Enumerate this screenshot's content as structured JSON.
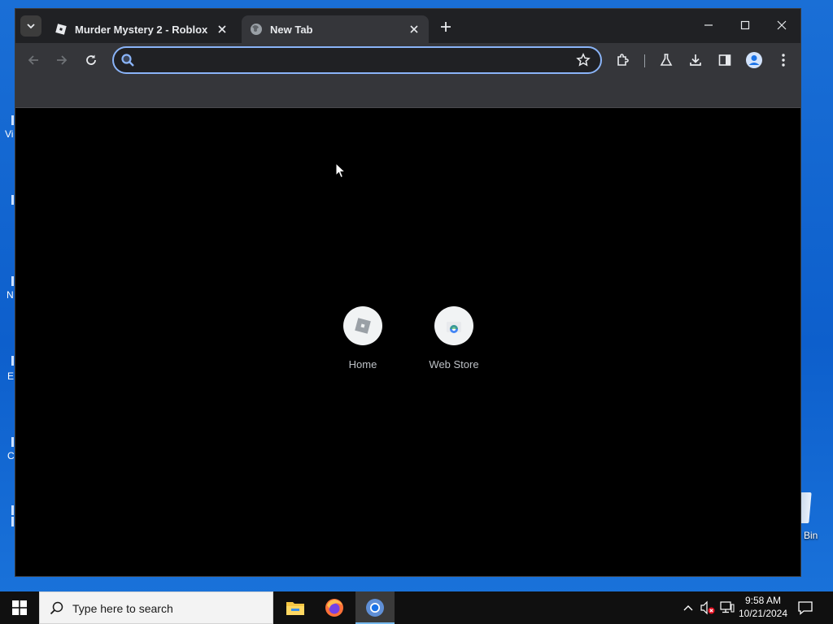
{
  "desktop": {
    "fragments": [
      "Vi",
      "N",
      "E",
      "C"
    ],
    "recycle_bin_label": "Bin"
  },
  "browser": {
    "tabs": [
      {
        "title": "Murder Mystery 2 - Roblox",
        "icon": "roblox-favicon",
        "active": false
      },
      {
        "title": "New Tab",
        "icon": "globe-favicon",
        "active": true
      }
    ],
    "address_bar": {
      "value": "",
      "placeholder": ""
    },
    "toolbar_icons": [
      "back-icon",
      "forward-icon",
      "reload-icon",
      "bookmark-star-icon",
      "extensions-icon",
      "labs-icon",
      "download-icon",
      "side-panel-icon",
      "profile-icon",
      "menu-icon"
    ],
    "shortcuts": [
      {
        "label": "Home",
        "icon": "roblox-icon"
      },
      {
        "label": "Web Store",
        "icon": "chrome-web-store-icon"
      }
    ],
    "accent_color": "#8ab4f8"
  },
  "taskbar": {
    "search_placeholder": "Type here to search",
    "apps": [
      "file-explorer-icon",
      "firefox-icon",
      "chrome-icon"
    ],
    "clock": {
      "time": "9:58 AM",
      "date": "10/21/2024"
    }
  }
}
